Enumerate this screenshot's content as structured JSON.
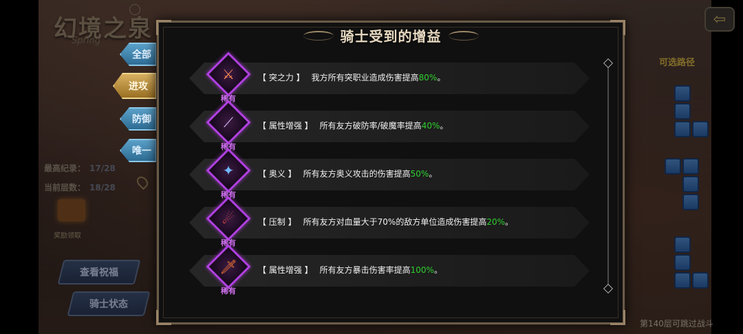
{
  "background": {
    "logo_text": "幻境之泉",
    "logo_sub": "Spring",
    "best_record_label": "最高纪录：",
    "best_record_value": "17/28",
    "current_floor_label": "当前层数：",
    "current_floor_value": "18/28",
    "reward_label": "奖励领取",
    "view_buttons": [
      "查看祝福",
      "骑士状态"
    ],
    "route_title": "可选路径",
    "footer_note": "第140层可跳过战斗",
    "back_icon": "back-arrow-icon"
  },
  "side_tabs": [
    {
      "label": "全部",
      "active": false
    },
    {
      "label": "进攻",
      "active": true
    },
    {
      "label": "防御",
      "active": false
    },
    {
      "label": "唯一",
      "active": false
    }
  ],
  "panel": {
    "title": "骑士受到的增益",
    "buffs": [
      {
        "name": "【 突之力 】",
        "desc": "我方所有突职业造成伤害提高",
        "pct": "80%",
        "tail": "。",
        "rarity": "稀有",
        "icon": "triple-blade-icon",
        "glyph": "⚔"
      },
      {
        "name": "【 属性增强 】",
        "desc": "所有友方破防率/破魔率提高",
        "pct": "40%",
        "tail": "。",
        "rarity": "稀有",
        "icon": "claw-slash-icon",
        "glyph": "⟋"
      },
      {
        "name": "【 奥义 】",
        "desc": "所有友方奥义攻击的伤害提高",
        "pct": "50%",
        "tail": "。",
        "rarity": "稀有",
        "icon": "blue-burst-icon",
        "glyph": "✦"
      },
      {
        "name": "【 压制 】",
        "desc": "所有友方对血量大于70%的敌方单位造成伤害提高",
        "pct": "20%",
        "tail": "。",
        "rarity": "稀有",
        "icon": "fire-claw-icon",
        "glyph": "☄"
      },
      {
        "name": "【 属性增强 】",
        "desc": "所有友方暴击伤害率提高",
        "pct": "100%",
        "tail": "。",
        "rarity": "稀有",
        "icon": "flame-sword-icon",
        "glyph": "🗡"
      }
    ]
  },
  "colors": {
    "accent_gold": "#d8b060",
    "rarity_purple": "#b040e0",
    "percent_green": "#2fd030",
    "tab_blue": "#5aa0c8"
  }
}
